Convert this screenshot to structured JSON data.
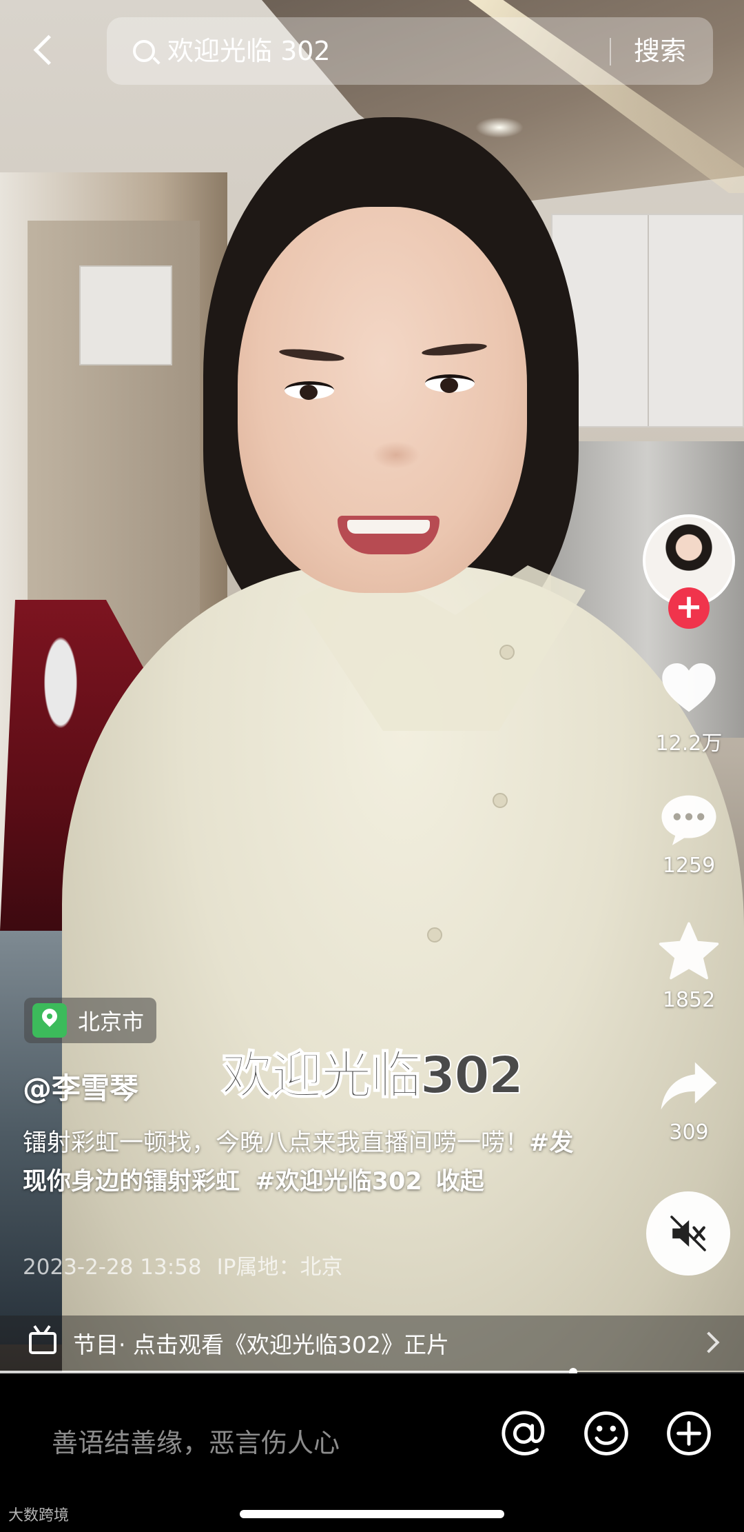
{
  "search": {
    "query": "欢迎光临 302",
    "button_label": "搜索"
  },
  "video": {
    "caption_overlay": "欢迎光临302"
  },
  "sidebar": {
    "follow_label": "+",
    "like_count": "12.2万",
    "comment_count": "1259",
    "favorite_count": "1852",
    "share_count": "309"
  },
  "post": {
    "location": "北京市",
    "author": "@李雪琴",
    "description_text": "镭射彩虹一顿找，今晚八点来我直播间唠一唠！",
    "hashtag_1": "#发现你身边的镭射彩虹",
    "hashtag_2": "#欢迎光临302",
    "collapse_label": "收起",
    "timestamp": "2023-2-28 13:58",
    "ip_location": "IP属地：北京"
  },
  "program": {
    "text": "节目· 点击观看《欢迎光临302》正片"
  },
  "playback": {
    "progress": 0.77
  },
  "comment_bar": {
    "placeholder": "善语结善缘，恶言伤人心"
  },
  "watermark": {
    "text": "大数跨境"
  },
  "colors": {
    "follow_red": "#f0344c",
    "location_green": "#3cbb5b"
  }
}
